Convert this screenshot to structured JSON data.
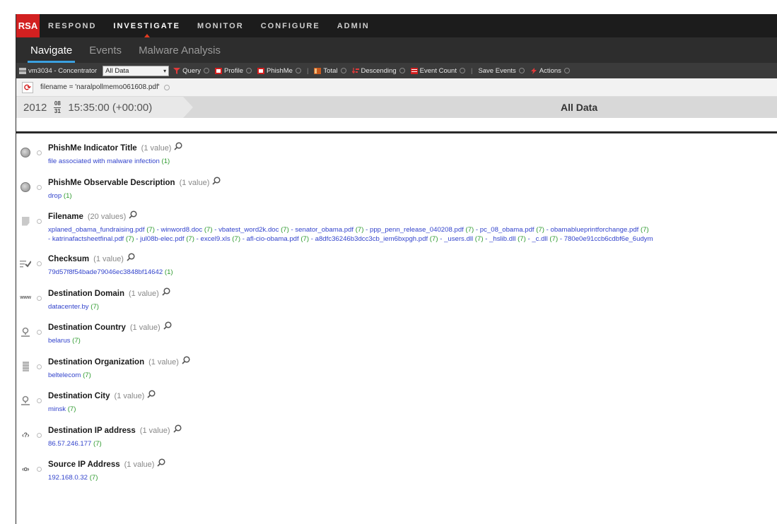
{
  "app": {
    "logo": "RSA",
    "top_nav": [
      {
        "label": "RESPOND"
      },
      {
        "label": "INVESTIGATE"
      },
      {
        "label": "MONITOR"
      },
      {
        "label": "CONFIGURE"
      },
      {
        "label": "ADMIN"
      }
    ],
    "active_top_nav": "INVESTIGATE",
    "sub_tabs": [
      {
        "label": "Navigate"
      },
      {
        "label": "Events"
      },
      {
        "label": "Malware Analysis"
      }
    ],
    "active_sub_tab": "Navigate"
  },
  "toolbar": {
    "source": "vm3034 - Concentrator",
    "scope_select": "All Data",
    "query": "Query",
    "profile": "Profile",
    "phishme": "PhishMe",
    "total": "Total",
    "sort": "Descending",
    "metric": "Event Count",
    "save_events": "Save Events",
    "actions": "Actions",
    "separator": "|"
  },
  "query_bar": {
    "filter": "filename = 'naralpollmemo061608.pdf'"
  },
  "time_bar": {
    "year": "2012",
    "month": "08",
    "day": "31",
    "time": "15:35:00 (+00:00)",
    "range_label": "All Data"
  },
  "meta_rows": [
    {
      "icon": "globe-icon",
      "title": "PhishMe Indicator Title",
      "count_text": "(1 value)",
      "lines": [
        [
          {
            "v": "file associated with malware infection",
            "c": "(1)"
          }
        ]
      ]
    },
    {
      "icon": "globe-icon",
      "title": "PhishMe Observable Description",
      "count_text": "(1 value)",
      "lines": [
        [
          {
            "v": "drop",
            "c": "(1)"
          }
        ]
      ]
    },
    {
      "icon": "document-icon",
      "title": "Filename",
      "count_text": "(20 values)",
      "lines": [
        [
          {
            "v": "xplaned_obama_fundraising.pdf",
            "c": "(7)"
          },
          {
            "v": "winword8.doc",
            "c": "(7)"
          },
          {
            "v": "vbatest_word2k.doc",
            "c": "(7)"
          },
          {
            "v": "senator_obama.pdf",
            "c": "(7)"
          },
          {
            "v": "ppp_penn_release_040208.pdf",
            "c": "(7)"
          },
          {
            "v": "pc_08_obama.pdf",
            "c": "(7)"
          },
          {
            "v": "obamablueprintforchange.pdf",
            "c": "(7)"
          }
        ],
        [
          {
            "v": "katrinafactsheetfinal.pdf",
            "c": "(7)"
          },
          {
            "v": "jul08b-elec.pdf",
            "c": "(7)"
          },
          {
            "v": "excel9.xls",
            "c": "(7)"
          },
          {
            "v": "afl-cio-obama.pdf",
            "c": "(7)"
          },
          {
            "v": "a8dfc36246b3dcc3cb_iem6bxpgh.pdf",
            "c": "(7)"
          },
          {
            "v": "_users.dll",
            "c": "(7)"
          },
          {
            "v": "_hslib.dll",
            "c": "(7)"
          },
          {
            "v": "_c.dll",
            "c": "(7)"
          },
          {
            "v": "780e0e91ccb6cdbf6e_6udym",
            "c": ""
          }
        ]
      ]
    },
    {
      "icon": "checksum-icon",
      "title": "Checksum",
      "count_text": "(1 value)",
      "lines": [
        [
          {
            "v": "79d57f8f54bade79046ec3848bf14642",
            "c": "(1)"
          }
        ]
      ]
    },
    {
      "icon": "www-icon",
      "title": "Destination Domain",
      "count_text": "(1 value)",
      "lines": [
        [
          {
            "v": "datacenter.by",
            "c": "(7)"
          }
        ]
      ]
    },
    {
      "icon": "location-pin-icon",
      "title": "Destination Country",
      "count_text": "(1 value)",
      "lines": [
        [
          {
            "v": "belarus",
            "c": "(7)"
          }
        ]
      ]
    },
    {
      "icon": "building-icon",
      "title": "Destination Organization",
      "count_text": "(1 value)",
      "lines": [
        [
          {
            "v": "beltelecom",
            "c": "(7)"
          }
        ]
      ]
    },
    {
      "icon": "location-pin-icon",
      "title": "Destination City",
      "count_text": "(1 value)",
      "lines": [
        [
          {
            "v": "minsk",
            "c": "(7)"
          }
        ]
      ]
    },
    {
      "icon": "ip-destination-icon",
      "title": "Destination IP address",
      "count_text": "(1 value)",
      "lines": [
        [
          {
            "v": "86.57.246.177",
            "c": "(7)"
          }
        ]
      ]
    },
    {
      "icon": "ip-source-icon",
      "title": "Source IP Address",
      "count_text": "(1 value)",
      "lines": [
        [
          {
            "v": "192.168.0.32",
            "c": "(7)"
          }
        ]
      ]
    }
  ],
  "icon_glyphs": {
    "www-icon": "www",
    "ip-destination-icon": "‹?›",
    "ip-source-icon": "‹o›"
  },
  "colors": {
    "brand": "#d22020",
    "accent": "#3aa0e0",
    "link": "#3344cc",
    "count": "#2e9a2e"
  }
}
